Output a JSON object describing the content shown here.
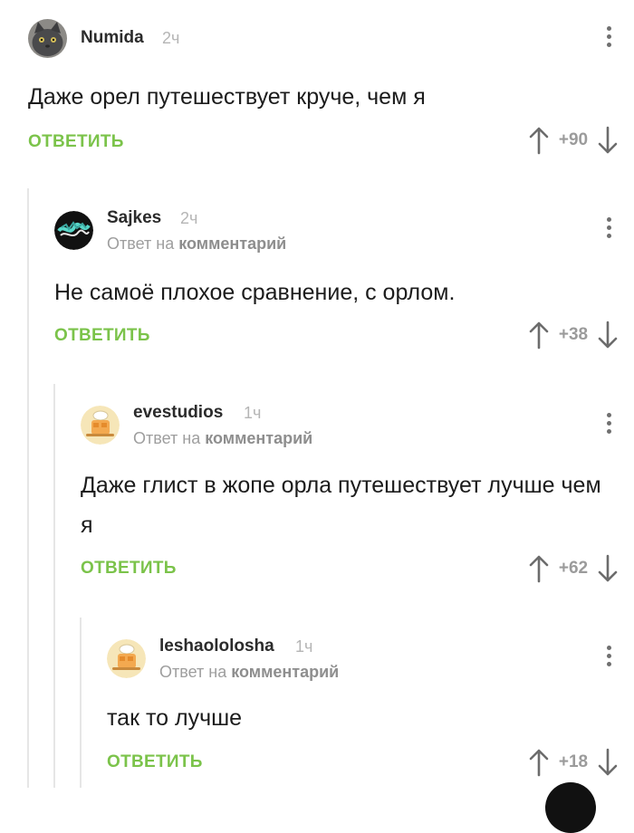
{
  "comments": [
    {
      "username": "Numida",
      "time": "2ч",
      "reply_prefix": "",
      "reply_link": "",
      "text": "Даже орел путешествует круче, чем я",
      "reply_label": "ОТВЕТИТЬ",
      "score": "+90",
      "avatar_icon": "cat-avatar-icon"
    },
    {
      "username": "Sajkes",
      "time": "2ч",
      "reply_prefix": "Ответ на",
      "reply_link": "комментарий",
      "text": "Не самоё плохое сравнение, с орлом.",
      "reply_label": "ОТВЕТИТЬ",
      "score": "+38",
      "avatar_icon": "graffiti-avatar-icon"
    },
    {
      "username": "evestudios",
      "time": "1ч",
      "reply_prefix": "Ответ на",
      "reply_link": "комментарий",
      "text": "Даже глист в жопе орла путешествует лучше чем я",
      "reply_label": "ОТВЕТИТЬ",
      "score": "+62",
      "avatar_icon": "chef-avatar-icon"
    },
    {
      "username": "leshaololosha",
      "time": "1ч",
      "reply_prefix": "Ответ на",
      "reply_link": "комментарий",
      "text": "так то лучше",
      "reply_label": "ОТВЕТИТЬ",
      "score": "+18",
      "avatar_icon": "chef-avatar-icon"
    }
  ],
  "colors": {
    "accent_green": "#7bc34a",
    "score_gray": "#9b9b9b",
    "thread_line": "#e6e6e6"
  }
}
